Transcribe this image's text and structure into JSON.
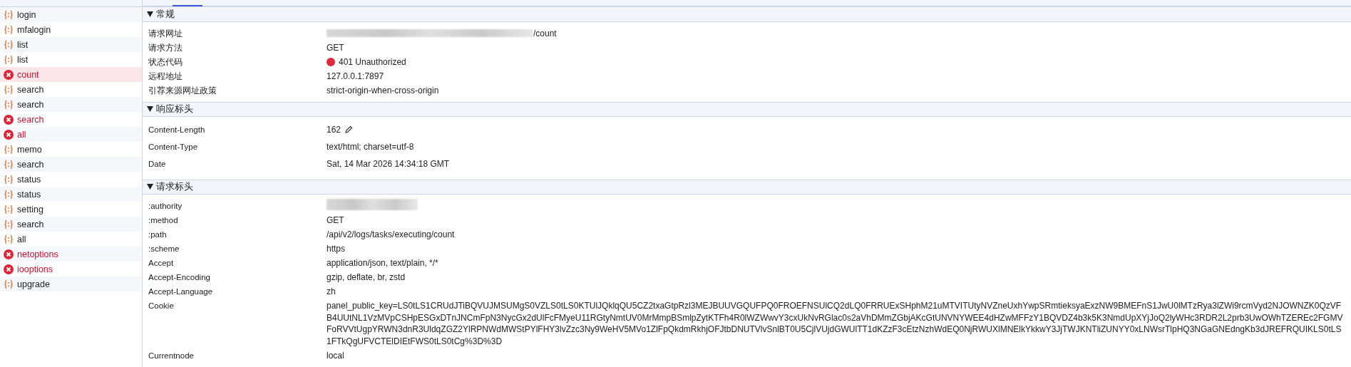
{
  "requests": [
    {
      "name": "login",
      "kind": "fetch",
      "selected": false
    },
    {
      "name": "mfalogin",
      "kind": "fetch",
      "selected": false
    },
    {
      "name": "list",
      "kind": "fetch",
      "selected": false
    },
    {
      "name": "list",
      "kind": "fetch",
      "selected": false
    },
    {
      "name": "count",
      "kind": "error",
      "selected": true
    },
    {
      "name": "search",
      "kind": "fetch",
      "selected": false
    },
    {
      "name": "search",
      "kind": "fetch",
      "selected": false
    },
    {
      "name": "search",
      "kind": "error",
      "selected": false
    },
    {
      "name": "all",
      "kind": "error",
      "selected": false
    },
    {
      "name": "memo",
      "kind": "fetch",
      "selected": false
    },
    {
      "name": "search",
      "kind": "fetch",
      "selected": false
    },
    {
      "name": "status",
      "kind": "fetch",
      "selected": false
    },
    {
      "name": "status",
      "kind": "fetch",
      "selected": false
    },
    {
      "name": "setting",
      "kind": "fetch",
      "selected": false
    },
    {
      "name": "search",
      "kind": "fetch",
      "selected": false
    },
    {
      "name": "all",
      "kind": "fetch",
      "selected": false
    },
    {
      "name": "netoptions",
      "kind": "error",
      "selected": false
    },
    {
      "name": "iooptions",
      "kind": "error",
      "selected": false
    },
    {
      "name": "upgrade",
      "kind": "fetch",
      "selected": false
    }
  ],
  "sections": [
    {
      "title": "常规",
      "expanded": true,
      "rows": [
        {
          "name": "请求网址",
          "kind": "redacted",
          "value": "/count"
        },
        {
          "name": "请求方法",
          "kind": "text",
          "value": "GET"
        },
        {
          "name": "状态代码",
          "kind": "status",
          "value": "401 Unauthorized",
          "color": "#dc2a3c"
        },
        {
          "name": "远程地址",
          "kind": "text",
          "value": "127.0.0.1:7897"
        },
        {
          "name": "引荐来源网址政策",
          "kind": "text",
          "value": "strict-origin-when-cross-origin"
        }
      ]
    },
    {
      "title": "响应标头",
      "expanded": true,
      "rows": [
        {
          "name": "Content-Length",
          "kind": "editable",
          "value": "162"
        },
        {
          "name": "Content-Type",
          "kind": "text",
          "value": "text/html; charset=utf-8"
        },
        {
          "name": "Date",
          "kind": "text",
          "value": "Sat, 14 Mar 2026 14:34:18 GMT"
        }
      ]
    },
    {
      "title": "请求标头",
      "expanded": true,
      "rows": [
        {
          "name": ":authority",
          "kind": "hidden"
        },
        {
          "name": ":method",
          "kind": "text",
          "value": "GET"
        },
        {
          "name": ":path",
          "kind": "text",
          "value": "/api/v2/logs/tasks/executing/count"
        },
        {
          "name": ":scheme",
          "kind": "text",
          "value": "https"
        },
        {
          "name": "Accept",
          "kind": "text",
          "value": "application/json, text/plain, */*"
        },
        {
          "name": "Accept-Encoding",
          "kind": "text",
          "value": "gzip, deflate, br, zstd"
        },
        {
          "name": "Accept-Language",
          "kind": "text",
          "value": "zh"
        },
        {
          "name": "Cookie",
          "kind": "text",
          "value": "panel_public_key=LS0tLS1CRUdJTiBQVUJMSUMgS0VZLS0tLS0KTUlJQklqQU5CZ2txaGtpRzl3MEJBUUVGQUFPQ0FROEFNSUlCQ2dLQ0FRRUExSHphM21uMTVITUtyNVZneUxhYwpSRmtieksyaExzNW9BMEFnS1JwU0lMTzRya3lZWi9rcmVyd2NJOWNZK0QzVFB4UUtNL1VzMVpCSHpESGxDTnJNCmFpN3NycGx2dUlFcFMyeU11RGtyNmtUV0MrMmpBSmlpZytKTFh4R0lWZWwvY3cxUkNvRGlac0s2aVhDMmZGbjAKcGtUNVNYWEE4dHZwMFFzY1BQVDZ4b3k5K3NmdUpXYjJoQ2lyWHc3RDR2L2prb3UwOWhTZEREc2FGMVFoRVVtUgpYRWN3dnR3UldqZGZ2YlRPNWdMWStPYlFHY3lvZzc3Ny9WeHV5MVo1ZlFpQkdmRkhjOFJtbDNUTVlvSnlBT0U5CjlVUjdGWUlTT1dKZzF3cEtzNzhWdEQ0NjRWUXlMNElkYkkwY3JjTWJKNTliZUNYY0xLNWsrTlpHQ3NGaGNEdngKb3dJREFRQUIKLS0tLS1FTkQgUFVCTElDIEtFWS0tLS0tCg%3D%3D"
        },
        {
          "name": "Currentnode",
          "kind": "text",
          "value": "local"
        }
      ]
    }
  ]
}
